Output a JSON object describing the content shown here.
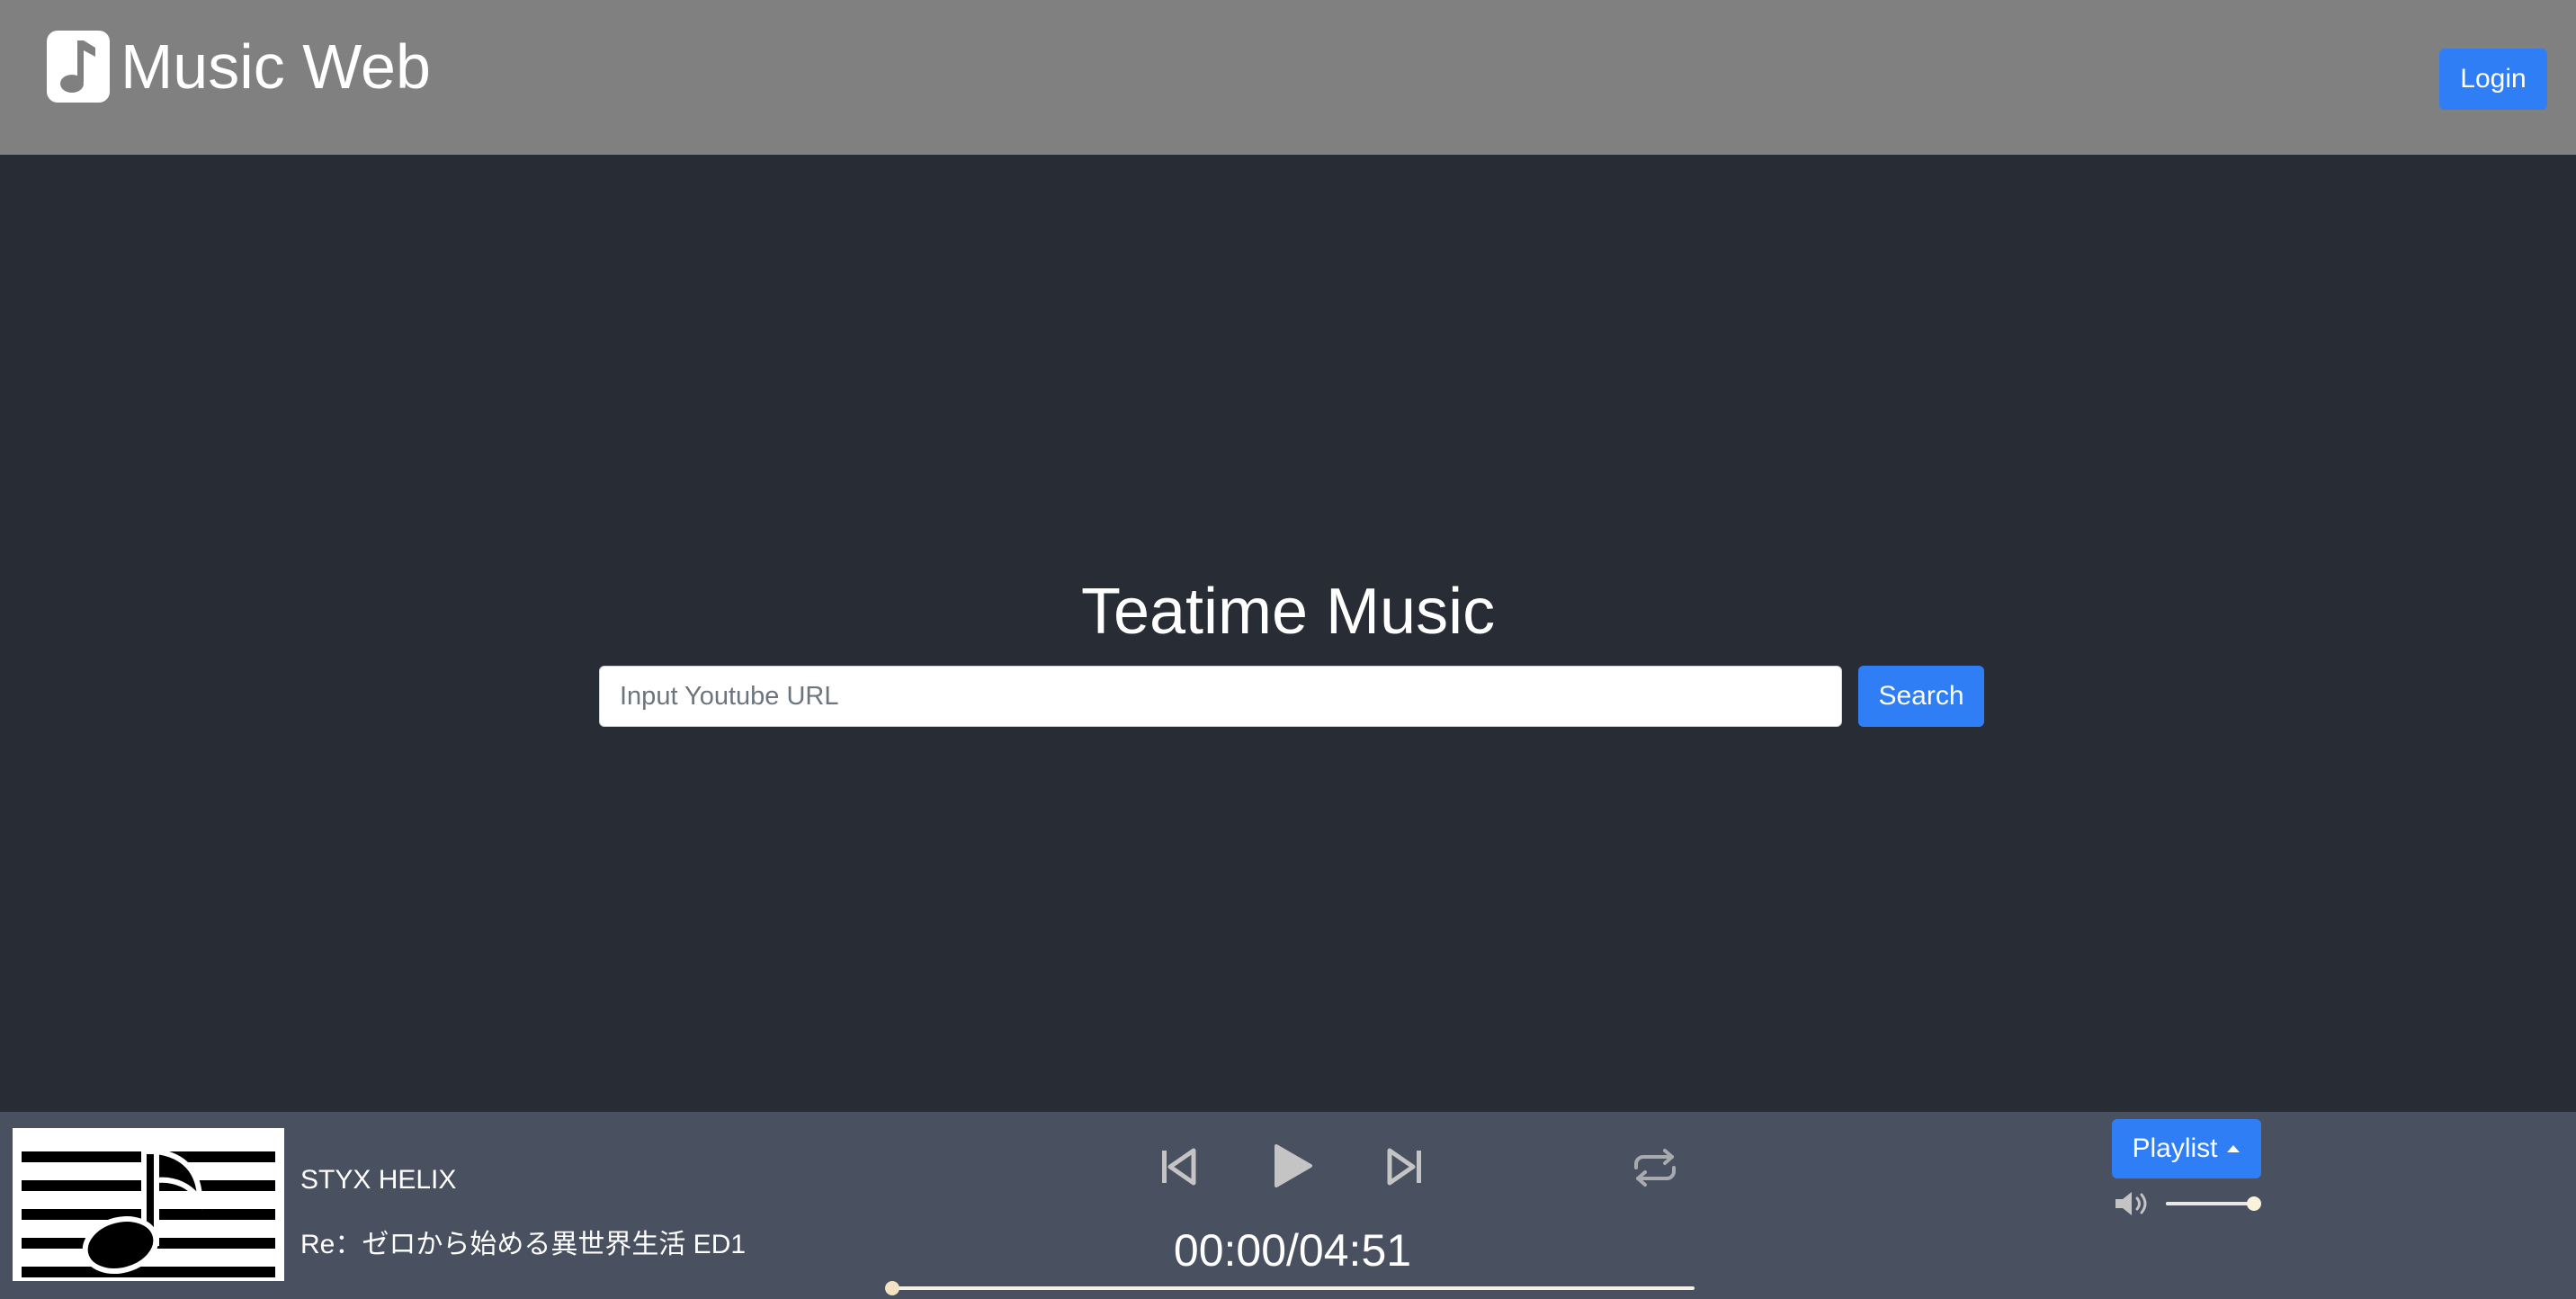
{
  "header": {
    "brand": "Music Web",
    "login_label": "Login"
  },
  "hero": {
    "title": "Teatime Music",
    "search_placeholder": "Input Youtube URL",
    "search_label": "Search"
  },
  "player": {
    "track_title": "STYX HELIX",
    "track_subtitle": "Re：ゼロから始める異世界生活 ED1",
    "current_time": "00:00",
    "duration": "04:51",
    "time_display": "00:00/04:51",
    "progress": 0,
    "volume": 1.0,
    "playlist_label": "Playlist"
  },
  "icons": {
    "brand": "music-note-icon",
    "previous": "skip-previous-icon",
    "play": "play-icon",
    "next": "skip-next-icon",
    "repeat": "repeat-icon",
    "playlist_caret": "caret-up-icon",
    "volume": "volume-icon",
    "cover": "music-note-icon"
  },
  "colors": {
    "header_bg": "#808080",
    "page_bg": "#282c34",
    "player_bg": "#495060",
    "accent": "#2f7ef6",
    "icon_gray": "#bcbcbc"
  }
}
